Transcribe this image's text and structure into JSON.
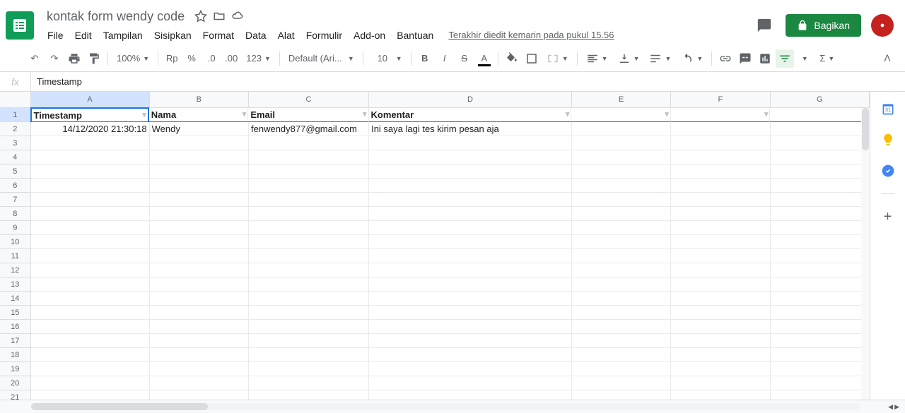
{
  "doc": {
    "title": "kontak form wendy code"
  },
  "menu": {
    "file": "File",
    "edit": "Edit",
    "view": "Tampilan",
    "insert": "Sisipkan",
    "format": "Format",
    "data": "Data",
    "tools": "Alat",
    "form": "Formulir",
    "addon": "Add-on",
    "help": "Bantuan"
  },
  "last_edit": "Terakhir diedit kemarin pada pukul 15.56",
  "share": {
    "label": "Bagikan"
  },
  "toolbar": {
    "zoom": "100%",
    "currency": "Rp",
    "percent": "%",
    "dec_dec": ".0",
    "dec_inc": ".00",
    "numfmt": "123",
    "font": "Default (Ari...",
    "size": "10",
    "bold": "B",
    "italic": "I",
    "strike": "S",
    "textcolor": "A"
  },
  "formula": {
    "fx": "fx",
    "value": "Timestamp"
  },
  "columns": [
    "A",
    "B",
    "C",
    "D",
    "E",
    "F",
    "G"
  ],
  "headers": {
    "A": "Timestamp",
    "B": "Nama",
    "C": "Email",
    "D": "Komentar"
  },
  "data_row": {
    "A": "14/12/2020 21:30:18",
    "B": "Wendy",
    "C": "fenwendy877@gmail.com",
    "D": "Ini saya lagi tes kirim pesan aja"
  },
  "row_count": 21,
  "active_cell": "A1"
}
